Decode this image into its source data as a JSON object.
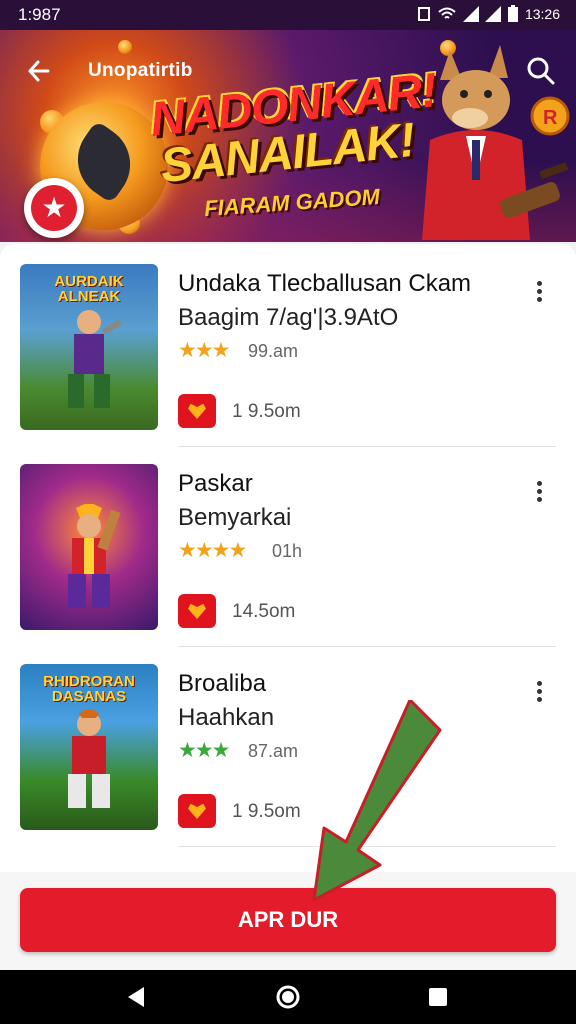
{
  "status_bar": {
    "time": "1:987",
    "right_text": "13:26",
    "icons": [
      "notification-icon",
      "wifi-icon",
      "signal-icon",
      "signal-icon",
      "battery-icon"
    ]
  },
  "header": {
    "title": "Unopatirtib",
    "back_icon": "arrow-left-icon",
    "search_icon": "search-icon"
  },
  "banner": {
    "headline_line1": "NADONKAR!",
    "headline_line2": "SANAILAK!",
    "subline": "FIARAM GADOM"
  },
  "list": [
    {
      "thumb_caption": "AURDAIK ALNEAK",
      "title": "Undaka Tlecballusan Ckam",
      "subtitle": "Baagim 7/ag'|3.9AtO",
      "rating_stars": 3,
      "rating_text": "99.am",
      "star_color": "#f2a21b",
      "size": "1 9.5om"
    },
    {
      "thumb_caption": "",
      "title": "Paskar",
      "subtitle": "Bemyarkai",
      "rating_stars": 4,
      "rating_text": "01h",
      "star_color": "#f2a21b",
      "size": "14.5om"
    },
    {
      "thumb_caption": "RHIDRORAN DASANAS",
      "title": "Broaliba",
      "subtitle": "Haahkan",
      "rating_stars": 3,
      "rating_text": "87.am",
      "star_color": "#3aa83a",
      "size": "1 9.5om"
    }
  ],
  "action_button": {
    "label": "APR DUR"
  },
  "nav": {
    "back": "triangle-back-icon",
    "home": "circle-home-icon",
    "recents": "square-recents-icon"
  },
  "colors": {
    "accent_red": "#e31b2b",
    "banner_purple": "#2d0f4f"
  }
}
